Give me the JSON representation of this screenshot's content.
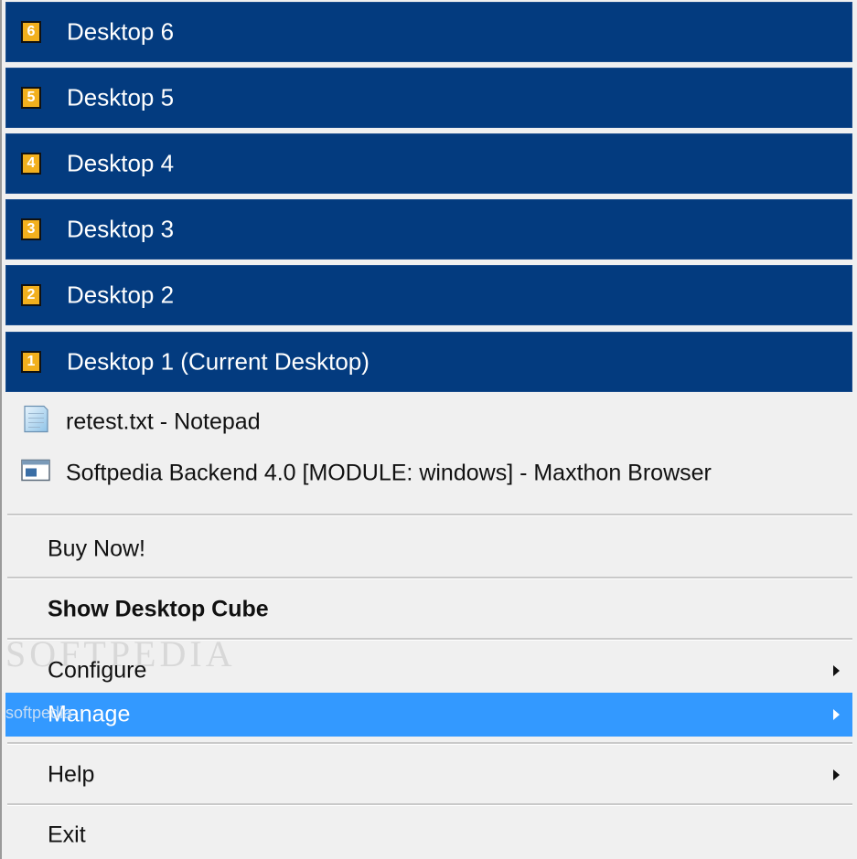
{
  "desktops": [
    {
      "number": "6",
      "label": "Desktop 6"
    },
    {
      "number": "5",
      "label": "Desktop 5"
    },
    {
      "number": "4",
      "label": "Desktop 4"
    },
    {
      "number": "3",
      "label": "Desktop 3"
    },
    {
      "number": "2",
      "label": "Desktop 2"
    },
    {
      "number": "1",
      "label": "Desktop 1 (Current Desktop)"
    }
  ],
  "windows": [
    {
      "label": "retest.txt - Notepad",
      "icon": "notepad-icon"
    },
    {
      "label": "Softpedia Backend 4.0 [MODULE: windows] - Maxthon Browser",
      "icon": "browser-window-icon"
    }
  ],
  "commands": {
    "buy_now": "Buy Now!",
    "show_desktop_cube": "Show Desktop Cube",
    "configure": "Configure",
    "manage": "Manage",
    "help": "Help",
    "exit": "Exit"
  },
  "watermark": {
    "large": "SOFTPEDIA",
    "small": "softpedia"
  },
  "colors": {
    "desktop_item_bg": "#033b7f",
    "badge": "#f2b01e",
    "highlight": "#3399ff",
    "menu_bg": "#f0f0f0"
  }
}
